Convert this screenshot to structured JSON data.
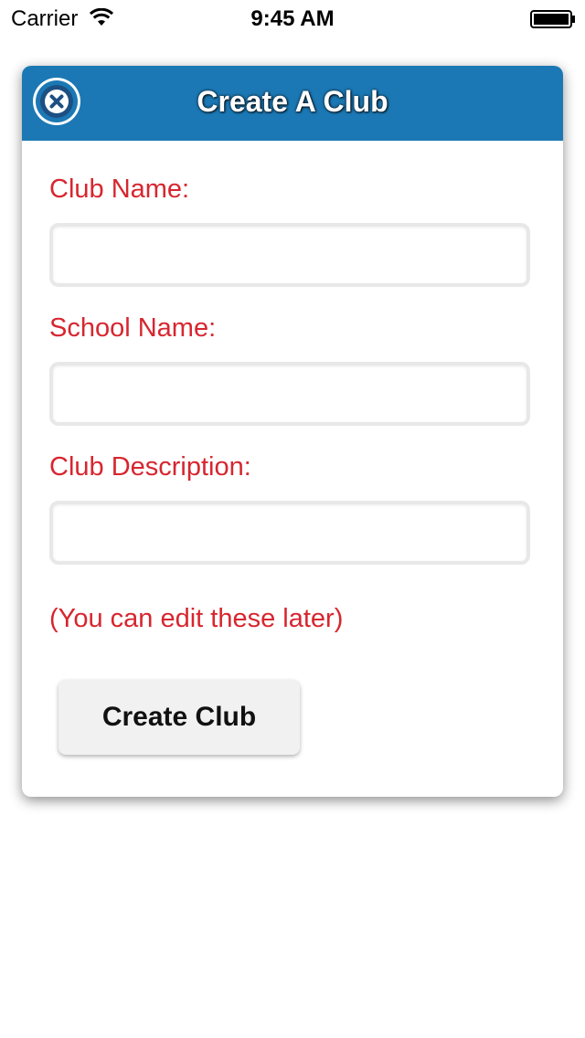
{
  "status_bar": {
    "carrier": "Carrier",
    "time": "9:45 AM"
  },
  "dialog": {
    "title": "Create A Club",
    "close_icon": "close-icon",
    "header_color": "#1b78b4",
    "fields": [
      {
        "label": "Club Name:",
        "value": "",
        "placeholder": ""
      },
      {
        "label": "School Name:",
        "value": "",
        "placeholder": ""
      },
      {
        "label": "Club Description:",
        "value": "",
        "placeholder": ""
      }
    ],
    "hint": "(You can edit these later)",
    "submit_label": "Create Club",
    "label_color": "#d7262f"
  }
}
